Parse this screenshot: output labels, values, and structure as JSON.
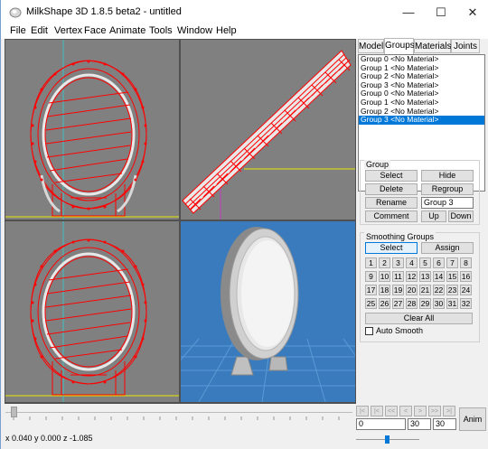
{
  "titlebar": {
    "title": "MilkShape 3D 1.8.5 beta2 - untitled",
    "minimize": "—",
    "maximize": "☐",
    "close": "✕"
  },
  "menu": [
    "File",
    "Edit",
    "Vertex",
    "Face",
    "Animate",
    "Tools",
    "Window",
    "Help"
  ],
  "tabs": [
    "Model",
    "Groups",
    "Materials",
    "Joints"
  ],
  "active_tab": "Groups",
  "groups": [
    "Group 0 <No Material>",
    "Group 1 <No Material>",
    "Group 2 <No Material>",
    "Group 3 <No Material>",
    "Group 0 <No Material>",
    "Group 1 <No Material>",
    "Group 2 <No Material>",
    "Group 3 <No Material>"
  ],
  "selected_group_index": 7,
  "group_box": {
    "label": "Group",
    "select": "Select",
    "hide": "Hide",
    "delete": "Delete",
    "regroup": "Regroup",
    "rename": "Rename",
    "name_value": "Group 3",
    "comment": "Comment",
    "up": "Up",
    "down": "Down"
  },
  "smoothing_box": {
    "label": "Smoothing Groups",
    "select": "Select",
    "assign": "Assign",
    "numbers": [
      "1",
      "2",
      "3",
      "4",
      "5",
      "6",
      "7",
      "8",
      "9",
      "10",
      "11",
      "12",
      "13",
      "14",
      "15",
      "16",
      "17",
      "18",
      "19",
      "20",
      "21",
      "22",
      "23",
      "24",
      "25",
      "26",
      "27",
      "28",
      "29",
      "30",
      "31",
      "32"
    ],
    "clear_all": "Clear All",
    "auto_smooth": "Auto Smooth",
    "auto_smooth_checked": false
  },
  "status": {
    "coords": "x 0.040 y 0.000 z -1.085"
  },
  "animation": {
    "frame_value": "0",
    "frame_current": "30",
    "frame_total": "30",
    "anim_button": "Anim",
    "transport": [
      "|<",
      "|<",
      "<<",
      "<",
      ">",
      ">>",
      ">|"
    ]
  },
  "colors": {
    "viewport_bg": "#808080",
    "viewport_3d_bg": "#3a7bbd",
    "wire": "#ff0000",
    "selection": "#0078d7",
    "axis_yellow": "#e8e800",
    "axis_magenta": "#c040c0",
    "axis_cyan": "#40c0c0"
  }
}
